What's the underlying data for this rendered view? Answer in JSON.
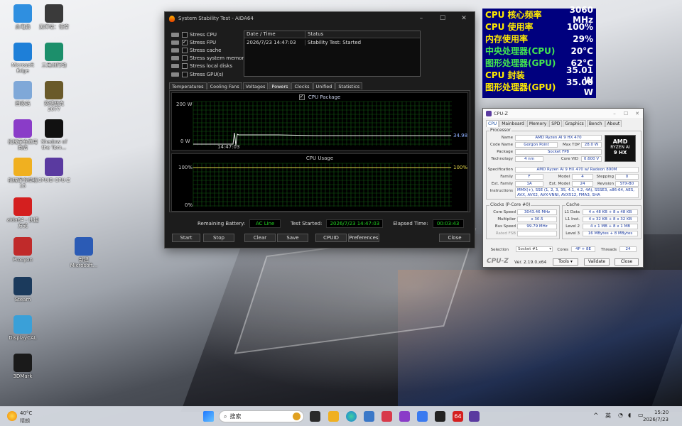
{
  "desktop_icons": [
    {
      "label": "此电脑",
      "color": "#2f8fe0"
    },
    {
      "label": "黑神话：悟空",
      "color": "#3a3a3a"
    },
    {
      "label": "Microsoft Edge",
      "color": "#1e7fd8"
    },
    {
      "label": "三角洲行动",
      "color": "#1c8f6b"
    },
    {
      "label": "回收站",
      "color": "#7fa8d8"
    },
    {
      "label": "赛博朋克 2077",
      "color": "#6a5a2a"
    },
    {
      "label": "机械革命应用商店",
      "color": "#8a3cc8"
    },
    {
      "label": "Shadow of the Tom...",
      "color": "#111111"
    },
    {
      "label": "机械革命壁纸15",
      "color": "#f0b020"
    },
    {
      "label": "CPUID CPU-Z",
      "color": "#5a3aa0"
    },
    {
      "label": "aida64 - 快捷方式",
      "color": "#d41f1f"
    },
    {
      "label": "新建 Microsoft...",
      "color": "#2b5bb5"
    },
    {
      "label": "Procyon",
      "color": "#c02a2a"
    },
    {
      "label": "Steam",
      "color": "#1b3a5c"
    },
    {
      "label": "DisplayCAL",
      "color": "#3aa0d8"
    },
    {
      "label": "3DMark",
      "color": "#1a1a1a"
    }
  ],
  "aida": {
    "title": "System Stability Test - AIDA64",
    "stress_items": [
      {
        "label": "Stress CPU",
        "checked": false
      },
      {
        "label": "Stress FPU",
        "checked": true
      },
      {
        "label": "Stress cache",
        "checked": false
      },
      {
        "label": "Stress system memory",
        "checked": false
      },
      {
        "label": "Stress local disks",
        "checked": false
      },
      {
        "label": "Stress GPU(s)",
        "checked": false
      }
    ],
    "status_headers": [
      "Date / Time",
      "Status"
    ],
    "status_rows": [
      [
        "2026/7/23 14:47:03",
        "Stability Test: Started"
      ]
    ],
    "tabs": [
      "Temperatures",
      "Cooling Fans",
      "Voltages",
      "Powers",
      "Clocks",
      "Unified",
      "Statistics"
    ],
    "active_tab": "Powers",
    "graph1": {
      "legend": "CPU Package",
      "y_top": "200 W",
      "y_bottom": "0 W",
      "time": "14:47:03",
      "current": "34.98"
    },
    "graph2": {
      "legend": "CPU Usage",
      "y_top": "100%",
      "y_bottom": "0%",
      "current": "100%"
    },
    "remaining_battery_label": "Remaining Battery:",
    "remaining_battery": "AC Line",
    "test_started_label": "Test Started:",
    "test_started": "2026/7/23 14:47:03",
    "elapsed_label": "Elapsed Time:",
    "elapsed": "00:03:43",
    "buttons": [
      "Start",
      "Stop",
      "Clear",
      "Save",
      "CPUID",
      "Preferences",
      "Close"
    ]
  },
  "overlay": [
    {
      "key": "CPU 核心频率",
      "value": "3060 MHz",
      "color": "#ffea00"
    },
    {
      "key": "CPU 使用率",
      "value": "100%",
      "color": "#ffea00"
    },
    {
      "key": "内存使用率",
      "value": "29%",
      "color": "#ffea00"
    },
    {
      "key": "中央处理器(CPU)",
      "value": "20°C",
      "color": "#43e84f"
    },
    {
      "key": "图形处理器(GPU)",
      "value": "62°C",
      "color": "#43e84f"
    },
    {
      "key": "CPU 封装",
      "value": "35.01 W",
      "color": "#ffea00"
    },
    {
      "key": "图形处理器(GPU)",
      "value": "35.00 W",
      "color": "#ffea00"
    }
  ],
  "cpuz": {
    "title": "CPU-Z",
    "tabs": [
      "CPU",
      "Mainboard",
      "Memory",
      "SPD",
      "Graphics",
      "Bench",
      "About"
    ],
    "processor_label": "Processor",
    "fields": {
      "name": {
        "label": "Name",
        "value": "AMD Ryzen AI 9 HX 470"
      },
      "codename": {
        "label": "Code Name",
        "value": "Gorgon Point"
      },
      "maxtdp": {
        "label": "Max TDP",
        "value": "28.0 W"
      },
      "package": {
        "label": "Package",
        "value": "Socket FP8"
      },
      "technology": {
        "label": "Technology",
        "value": "4 nm"
      },
      "corevid": {
        "label": "Core VID",
        "value": "0.600 V"
      },
      "spec": {
        "label": "Specification",
        "value": "AMD Ryzen AI 9 HX 470 w/ Radeon 890M"
      },
      "family": {
        "label": "Family",
        "value": "F"
      },
      "model": {
        "label": "Model",
        "value": "4"
      },
      "stepping": {
        "label": "Stepping",
        "value": "0"
      },
      "extfamily": {
        "label": "Ext. Family",
        "value": "1A"
      },
      "extmodel": {
        "label": "Ext. Model",
        "value": "24"
      },
      "revision": {
        "label": "Revision",
        "value": "STX-B0"
      },
      "instructions": {
        "label": "Instructions",
        "line1": "MMX(+), SSE (1, 2, 3, 3S, 4.1, 4.2, 4A), SSSE3, x86-64, AES,",
        "line2": "AVX, AVX2, AVX-VNNI, AVX512, FMA3, SHA"
      }
    },
    "clocks_label": "Clocks (P-Core #0)",
    "clocks": [
      {
        "label": "Core Speed",
        "value": "3043.46 MHz"
      },
      {
        "label": "Multiplier",
        "value": "x 30.5"
      },
      {
        "label": "Bus Speed",
        "value": "99.79 MHz"
      },
      {
        "label": "Rated FSB",
        "value": ""
      }
    ],
    "cache_label": "Cache",
    "cache": [
      {
        "label": "L1 Data",
        "value": "4 x 48 KB + 8 x 48 KB"
      },
      {
        "label": "L1 Inst.",
        "value": "4 x 32 KB + 8 x 32 KB"
      },
      {
        "label": "Level 2",
        "value": "4 x 1 MB + 8 x 1 MB"
      },
      {
        "label": "Level 3",
        "value": "16 MBytes + 8 MBytes"
      }
    ],
    "selection_label": "Selection",
    "selection": "Socket #1",
    "cores_label": "Cores",
    "cores": "4P + 8E",
    "threads_label": "Threads",
    "threads": "24",
    "logo_amd": "AMD",
    "logo_ryzen": "RYZEN AI",
    "logo_9hx": "9 HX",
    "brand": "CPU-Z",
    "version": "Ver. 2.19.0.x64",
    "tools_label": "Tools",
    "validate_label": "Validate",
    "close_label": "Close"
  },
  "taskbar": {
    "weather_temp": "40°C",
    "weather_desc": "晴朗",
    "search_placeholder": "搜索",
    "ime": "英",
    "time": "15:20",
    "date": "2026/7/23"
  }
}
